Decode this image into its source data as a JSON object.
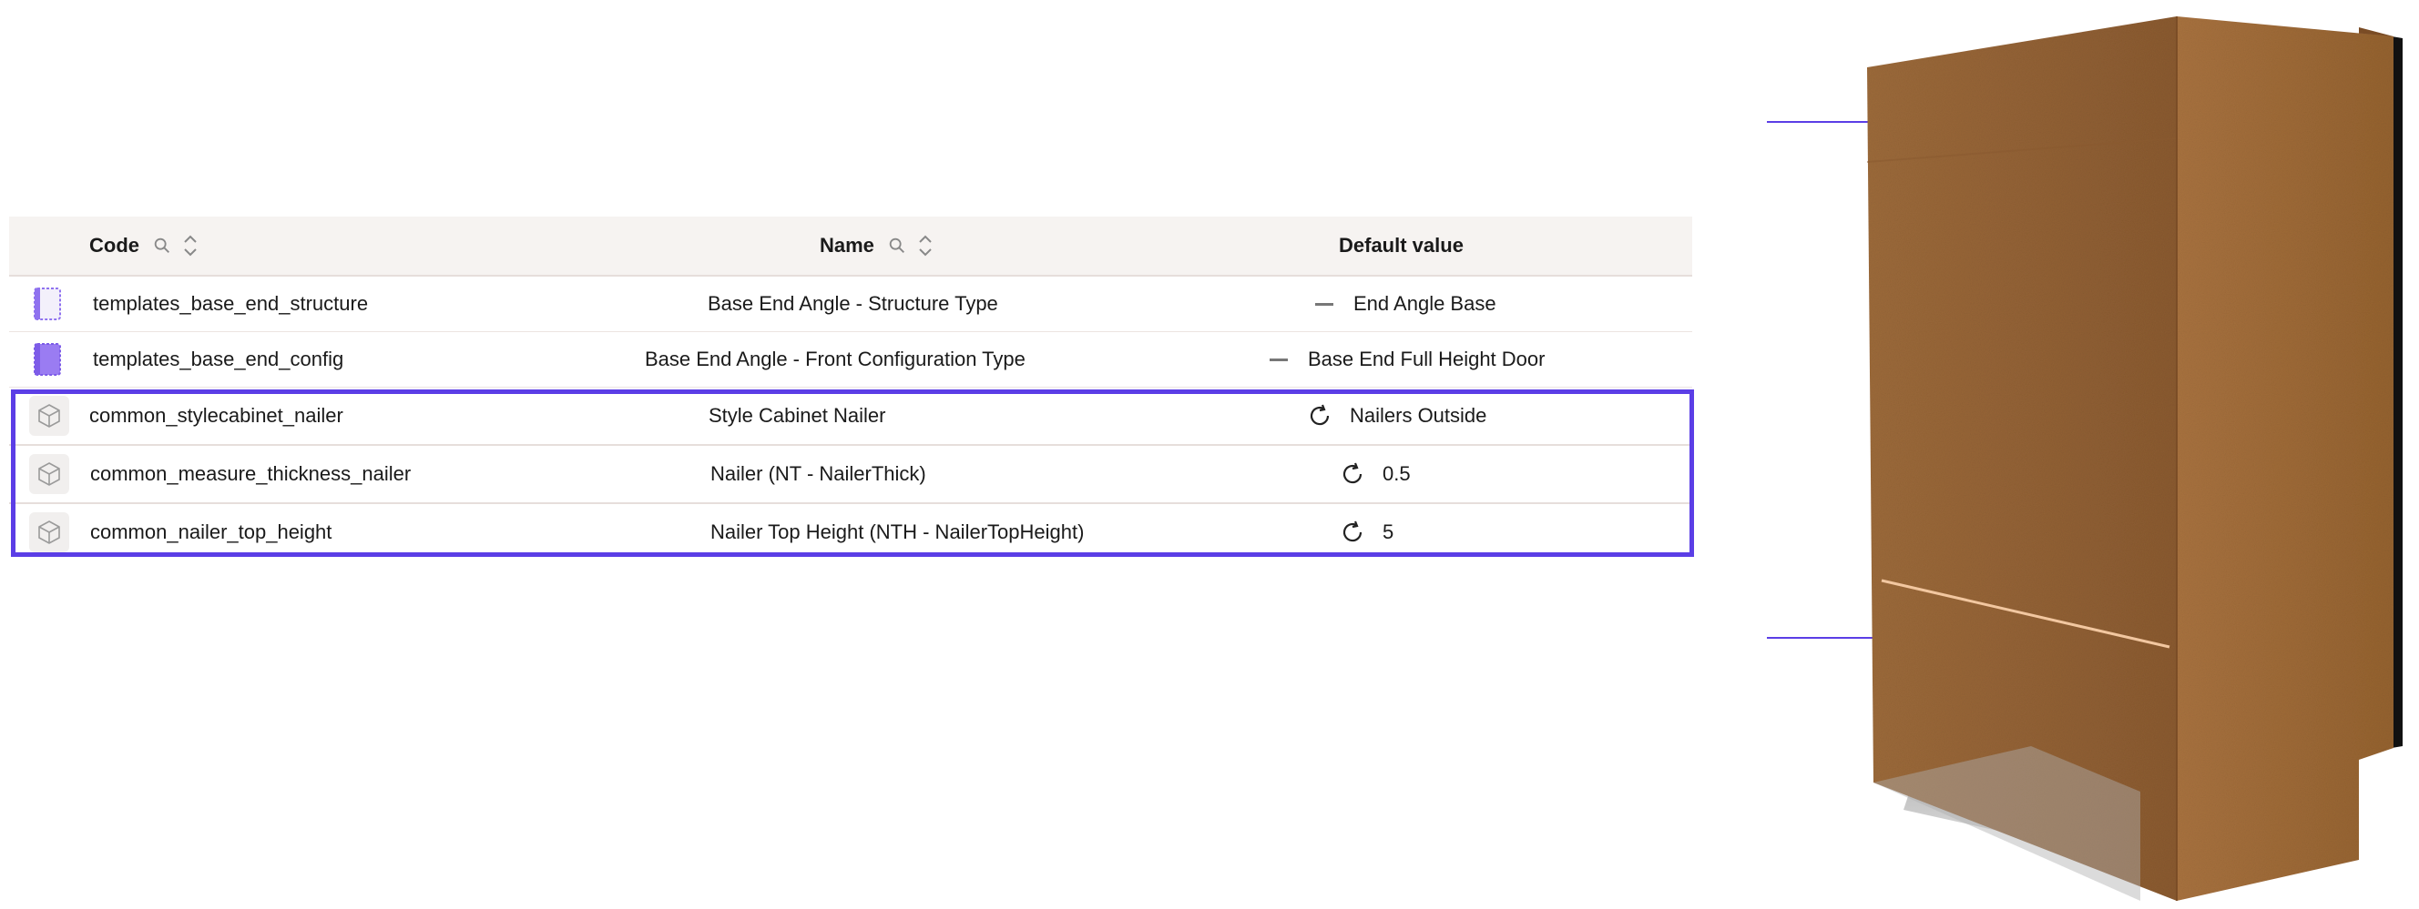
{
  "table": {
    "headers": {
      "code": "Code",
      "name": "Name",
      "default_value": "Default value"
    },
    "rows": [
      {
        "code": "templates_base_end_structure",
        "name": "Base End Angle - Structure Type",
        "default": "End Angle Base",
        "value_icon": "dash-icon",
        "type_icon": "template-icon"
      },
      {
        "code": "templates_base_end_config",
        "name": "Base End Angle - Front Configuration Type",
        "default": "Base End Full Height Door",
        "value_icon": "dash-icon",
        "type_icon": "template-icon"
      },
      {
        "code": "common_stylecabinet_nailer",
        "name": "Style Cabinet Nailer",
        "default": "Nailers Outside",
        "value_icon": "refresh-icon",
        "type_icon": "cube-icon"
      },
      {
        "code": "common_measure_thickness_nailer",
        "name": "Nailer (NT - NailerThick)",
        "default": "0.5",
        "value_icon": "refresh-icon",
        "type_icon": "cube-icon"
      },
      {
        "code": "common_nailer_top_height",
        "name": "Nailer Top Height (NTH - NailerTopHeight)",
        "default": "5",
        "value_icon": "refresh-icon",
        "type_icon": "cube-icon"
      }
    ]
  },
  "colors": {
    "accent": "#5b3ee6",
    "header_bg": "#f6f3f1",
    "wood": "#9a6a3d"
  }
}
